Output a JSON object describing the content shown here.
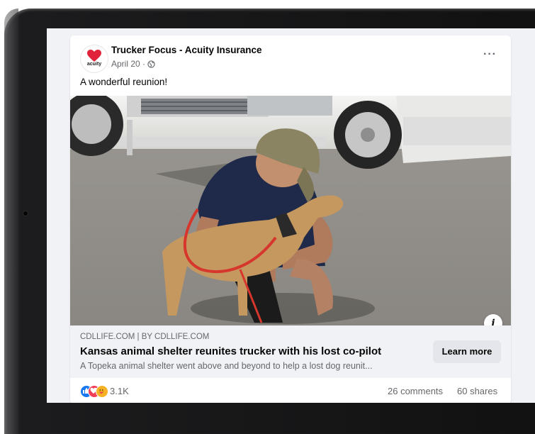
{
  "colors": {
    "brand_red": "#e0233a",
    "link_bg": "#f0f2f5",
    "like_blue": "#1877f2",
    "love_red": "#f33e58",
    "care_yellow": "#f7b125"
  },
  "post": {
    "page_name": "Trucker Focus - Acuity Insurance",
    "logo_text": "acuity",
    "date": "April 20 ·",
    "privacy_icon": "globe-icon",
    "more_label": "···",
    "text": "A wonderful reunion!"
  },
  "media": {
    "info_label": "i"
  },
  "link": {
    "domain": "CDLLIFE.COM | BY CDLLIFE.COM",
    "title": "Kansas animal shelter reunites trucker with his lost co-pilot",
    "description": "A Topeka animal shelter went above and beyond to help a lost dog reunit...",
    "cta": "Learn more"
  },
  "engagement": {
    "reaction_icons": [
      "like-icon",
      "love-icon",
      "care-icon"
    ],
    "reaction_count": "3.1K",
    "comments": "26 comments",
    "shares": "60 shares"
  }
}
